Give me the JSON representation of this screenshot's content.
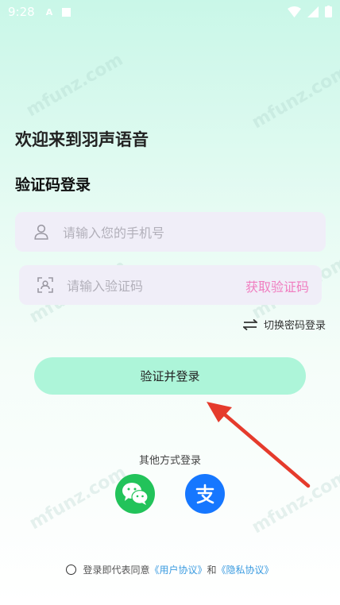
{
  "status_bar": {
    "time": "9:28",
    "notif_icon": "A"
  },
  "header": {
    "welcome": "欢迎来到羽声语音",
    "section_title": "验证码登录"
  },
  "form": {
    "phone_placeholder": "请输入您的手机号",
    "code_placeholder": "请输入验证码",
    "get_code_label": "获取验证码",
    "switch_label": "切换密码登录",
    "submit_label": "验证并登录"
  },
  "social": {
    "title": "其他方式登录",
    "items": [
      {
        "name": "wechat",
        "icon": "wechat-icon",
        "color": "#22c35a"
      },
      {
        "name": "alipay",
        "icon": "alipay-icon",
        "color": "#1677ff"
      }
    ]
  },
  "agreement": {
    "prefix": "登录即代表同意",
    "user_agreement": "《用户协议》",
    "and": "和",
    "privacy_agreement": "《隐私协议》"
  },
  "colors": {
    "accent": "#adf5d9",
    "get_code": "#f07ec0",
    "link": "#3a9be0",
    "annotation_arrow": "#e53b2c"
  },
  "watermark": "mfunz.com"
}
